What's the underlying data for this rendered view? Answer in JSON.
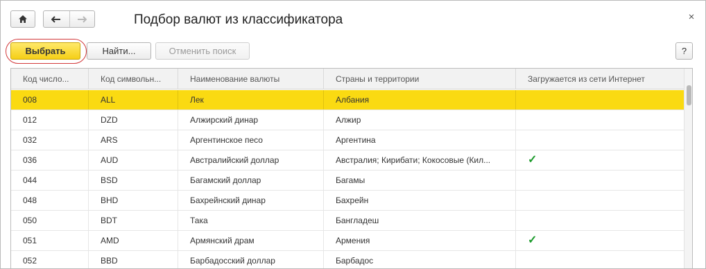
{
  "window": {
    "title": "Подбор валют из классификатора",
    "close_glyph": "×"
  },
  "icons": {
    "home": "home-icon",
    "back": "arrow-left-icon",
    "forward": "arrow-right-icon",
    "close": "close-icon",
    "check": "checkmark-icon"
  },
  "toolbar": {
    "select_label": "Выбрать",
    "find_label": "Найти...",
    "cancel_search_label": "Отменить поиск",
    "help_label": "?"
  },
  "table": {
    "columns": [
      "Код число...",
      "Код символьн...",
      "Наименование валюты",
      "Страны и территории",
      "Загружается из сети Интернет"
    ],
    "rows": [
      {
        "num": "008",
        "sym": "ALL",
        "name": "Лек",
        "countries": "Албания",
        "internet": "",
        "selected": true
      },
      {
        "num": "012",
        "sym": "DZD",
        "name": "Алжирский динар",
        "countries": "Алжир",
        "internet": ""
      },
      {
        "num": "032",
        "sym": "ARS",
        "name": "Аргентинское песо",
        "countries": "Аргентина",
        "internet": ""
      },
      {
        "num": "036",
        "sym": "AUD",
        "name": "Австралийский доллар",
        "countries": "Австралия; Кирибати; Кокосовые (Кил...",
        "internet": "✓"
      },
      {
        "num": "044",
        "sym": "BSD",
        "name": "Багамский доллар",
        "countries": "Багамы",
        "internet": ""
      },
      {
        "num": "048",
        "sym": "BHD",
        "name": "Бахрейнский динар",
        "countries": "Бахрейн",
        "internet": ""
      },
      {
        "num": "050",
        "sym": "BDT",
        "name": "Така",
        "countries": "Бангладеш",
        "internet": ""
      },
      {
        "num": "051",
        "sym": "AMD",
        "name": "Армянский драм",
        "countries": "Армения",
        "internet": "✓"
      },
      {
        "num": "052",
        "sym": "BBD",
        "name": "Барбадосский доллар",
        "countries": "Барбадос",
        "internet": ""
      }
    ]
  },
  "colors": {
    "selected_row": "#fada12",
    "primary_button": "#f5cf16",
    "highlight_ring": "#d2383a",
    "check": "#1a9a2a"
  }
}
